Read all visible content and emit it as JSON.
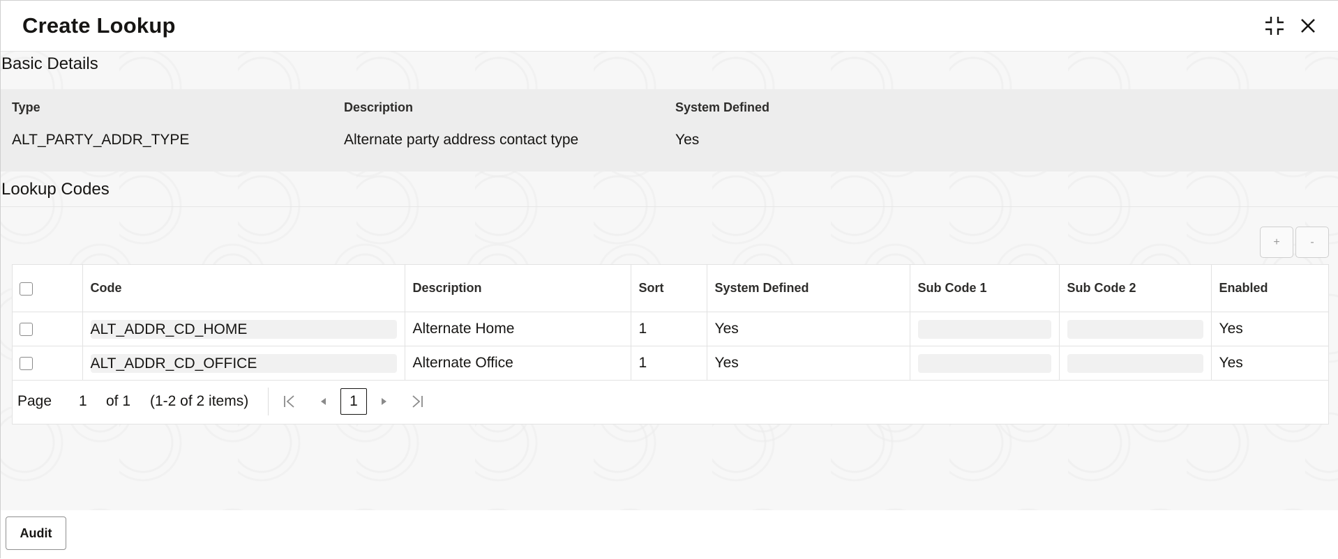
{
  "dialog": {
    "title": "Create Lookup",
    "icons": {
      "minimize": "collapse-icon",
      "close": "close-icon"
    }
  },
  "basic_details": {
    "heading": "Basic Details",
    "fields": [
      {
        "label": "Type",
        "value": "ALT_PARTY_ADDR_TYPE"
      },
      {
        "label": "Description",
        "value": "Alternate party address contact type"
      },
      {
        "label": "System Defined",
        "value": "Yes"
      }
    ]
  },
  "lookup_codes": {
    "heading": "Lookup Codes",
    "toolbar": {
      "add_label": "+",
      "remove_label": "-"
    },
    "columns": [
      "Code",
      "Description",
      "Sort",
      "System Defined",
      "Sub Code 1",
      "Sub Code 2",
      "Enabled"
    ],
    "rows": [
      {
        "code": "ALT_ADDR_CD_HOME",
        "description": "Alternate Home",
        "sort": "1",
        "system_defined": "Yes",
        "sub_code_1": "",
        "sub_code_2": "",
        "enabled": "Yes"
      },
      {
        "code": "ALT_ADDR_CD_OFFICE",
        "description": "Alternate Office",
        "sort": "1",
        "system_defined": "Yes",
        "sub_code_1": "",
        "sub_code_2": "",
        "enabled": "Yes"
      }
    ],
    "pagination": {
      "page_label": "Page",
      "page_value": "1",
      "of_label": "of 1",
      "items_label": "(1-2 of 2 items)",
      "current_page": "1"
    }
  },
  "footer": {
    "audit_label": "Audit"
  },
  "colors": {
    "panel_bg": "#ededed",
    "text": "#161513",
    "border": "#e2e2e2"
  }
}
